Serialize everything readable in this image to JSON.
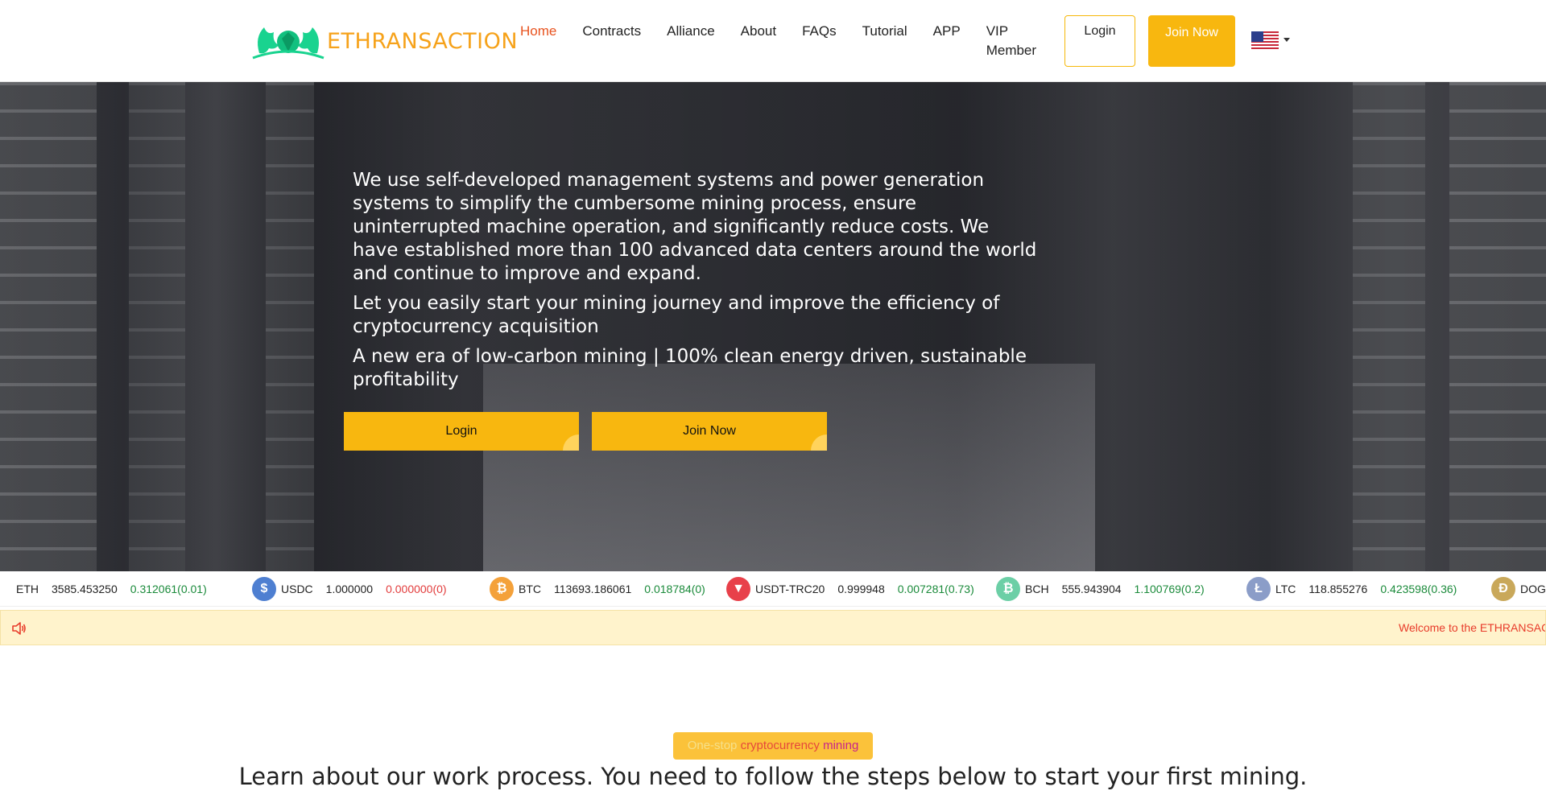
{
  "header": {
    "logo_text": "ETHRANSACTION",
    "nav": [
      {
        "label": "Home",
        "active": true
      },
      {
        "label": "Contracts"
      },
      {
        "label": "Alliance"
      },
      {
        "label": "About"
      },
      {
        "label": "FAQs"
      },
      {
        "label": "Tutorial"
      },
      {
        "label": "APP"
      },
      {
        "label": "VIP Member"
      }
    ],
    "login_label": "Login",
    "join_label": "Join Now",
    "language_icon": "us-flag-icon"
  },
  "hero": {
    "paragraph1": "We use self-developed management systems and power generation systems to simplify the cumbersome mining process, ensure uninterrupted machine operation, and significantly reduce costs. We have established more than 100 advanced data centers around the world and continue to improve and expand.",
    "paragraph2": "Let you easily start your mining journey and improve the efficiency of cryptocurrency acquisition",
    "paragraph3": "A new era of low-carbon mining | 100% clean energy driven, sustainable profitability",
    "login_button": "Login",
    "join_button": "Join Now"
  },
  "ticker": [
    {
      "symbol": "ETH",
      "price": "3585.453250",
      "change": "0.312061(0.01)",
      "direction": "up",
      "icon": "eth-icon"
    },
    {
      "symbol": "USDC",
      "price": "1.000000",
      "change": "0.000000(0)",
      "direction": "down",
      "icon": "usdc-icon",
      "color": "#4e7fd1"
    },
    {
      "symbol": "BTC",
      "price": "113693.186061",
      "change": "0.018784(0)",
      "direction": "up",
      "icon": "btc-icon",
      "color": "#f4a13a"
    },
    {
      "symbol": "USDT-TRC20",
      "price": "0.999948",
      "change": "0.007281(0.73)",
      "direction": "up",
      "icon": "tron-icon",
      "color": "#e8404a"
    },
    {
      "symbol": "BCH",
      "price": "555.943904",
      "change": "1.100769(0.2)",
      "direction": "up",
      "icon": "bch-icon",
      "color": "#6ccfa6"
    },
    {
      "symbol": "LTC",
      "price": "118.855276",
      "change": "0.423598(0.36)",
      "direction": "up",
      "icon": "ltc-icon",
      "color": "#8b9dc8"
    },
    {
      "symbol": "DOGE",
      "icon": "doge-icon",
      "color": "#c9a85a"
    }
  ],
  "notice": {
    "text": "Welcome to the ETHRANSAC"
  },
  "section": {
    "badge_part1": "One-stop",
    "badge_part2": "cryptocurrency",
    "badge_part3": "mining",
    "title": "Learn about our work process. You need to follow the steps below to start your first mining."
  }
}
